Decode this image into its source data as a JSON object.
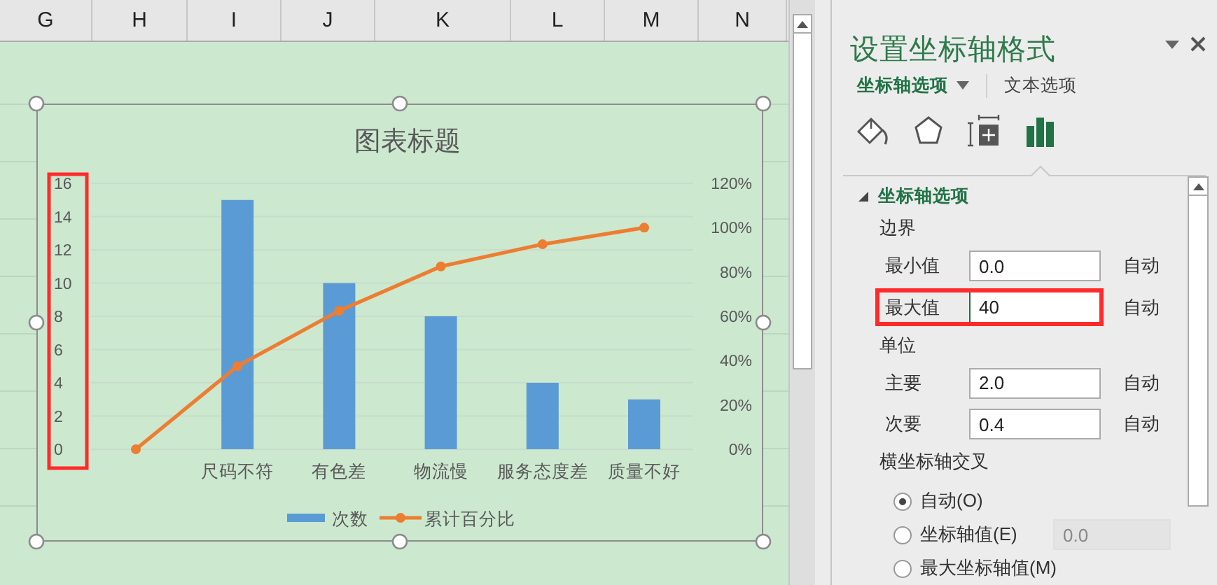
{
  "sheet": {
    "columns": [
      "G",
      "H",
      "I",
      "J",
      "K",
      "L",
      "M",
      "N"
    ]
  },
  "chart": {
    "title": "图表标题",
    "left_axis_highlighted": true,
    "selected": true,
    "bars": {
      "chart_data": {
        "type": "bar",
        "categories": [
          null,
          "尺码不符",
          "有色差",
          "物流慢",
          "服务态度差",
          "质量不好"
        ],
        "grid": true,
        "series": [
          {
            "name": "次数",
            "color": "#5b9bd5",
            "values": [
              null,
              15,
              10,
              8,
              4,
              3
            ]
          }
        ],
        "ylim": [
          0,
          16
        ],
        "yticks": [
          0,
          2,
          4,
          6,
          8,
          10,
          12,
          14,
          16
        ]
      }
    },
    "line": {
      "chart_data": {
        "type": "line",
        "categories": [
          null,
          null,
          null,
          null,
          null,
          null
        ],
        "series": [
          {
            "name": "累计百分比",
            "color": "#ed7d31",
            "marker": "circle",
            "values": [
              0,
              37.5,
              62.5,
              82.5,
              92.5,
              100
            ]
          }
        ],
        "ylim": [
          0,
          120
        ],
        "yticks": [
          {
            "value": 0,
            "label": "0%"
          },
          {
            "value": 20,
            "label": "20%"
          },
          {
            "value": 40,
            "label": "40%"
          },
          {
            "value": 60,
            "label": "60%"
          },
          {
            "value": 80,
            "label": "80%"
          },
          {
            "value": 100,
            "label": "100%"
          },
          {
            "value": 120,
            "label": "120%"
          }
        ]
      }
    }
  },
  "panel": {
    "title": "设置坐标轴格式",
    "tabs": [
      {
        "label": "坐标轴选项",
        "selected": true
      },
      {
        "label": "文本选项",
        "selected": false
      }
    ],
    "icons": [
      {
        "kind": "fill",
        "selected": false
      },
      {
        "kind": "shape",
        "selected": false
      },
      {
        "kind": "size",
        "selected": false
      },
      {
        "kind": "bars",
        "selected": true
      }
    ],
    "section": {
      "title": "坐标轴选项",
      "expanded": true
    },
    "groups": [
      {
        "heading": "边界",
        "rows": [
          {
            "label": "最小值",
            "value": "0.0",
            "reset": "自动",
            "highlighted": false,
            "focused": false
          },
          {
            "label": "最大值",
            "value": "40",
            "reset": "自动",
            "highlighted": true,
            "focused": true
          }
        ]
      },
      {
        "heading": "单位",
        "rows": [
          {
            "label": "主要",
            "value": "2.0",
            "reset": "自动",
            "highlighted": false,
            "focused": false
          },
          {
            "label": "次要",
            "value": "0.4",
            "reset": "自动",
            "highlighted": false,
            "focused": false
          }
        ]
      },
      {
        "heading": "横坐标轴交叉",
        "options": [
          {
            "label": "自动(O)",
            "selected": true
          },
          {
            "label": "坐标轴值(E)",
            "selected": false,
            "value": "0.0",
            "disabled": true
          },
          {
            "label": "最大坐标轴值(M)",
            "selected": false
          }
        ]
      }
    ]
  }
}
